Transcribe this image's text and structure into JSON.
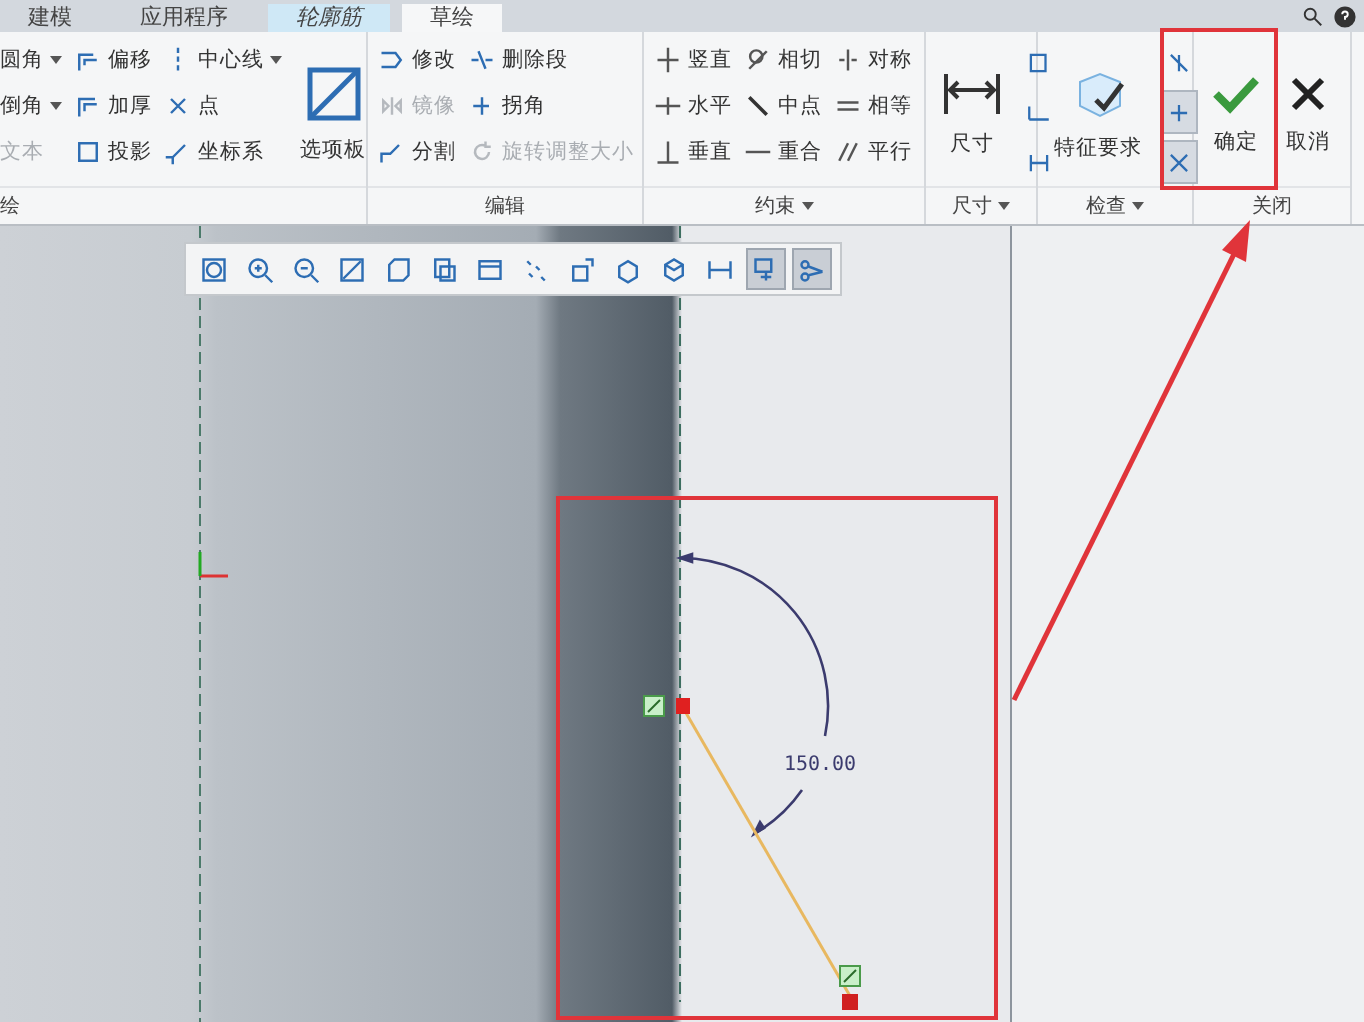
{
  "tabs": [
    {
      "label": "建模",
      "selected": false,
      "kind": "normal"
    },
    {
      "label": "应用程序",
      "selected": false,
      "kind": "normal"
    },
    {
      "label": "轮廓筋",
      "selected": false,
      "kind": "context"
    },
    {
      "label": "草绘",
      "selected": true,
      "kind": "normal"
    }
  ],
  "groups": [
    {
      "label": "绘",
      "has_menu": false,
      "blocks": [
        {
          "kind": "column",
          "items": [
            {
              "label": "圆角",
              "has_menu": true,
              "disabled": false
            },
            {
              "label": "倒角",
              "has_menu": true,
              "disabled": false
            },
            {
              "label": "文本",
              "has_menu": false,
              "disabled": true
            }
          ]
        },
        {
          "kind": "column",
          "items": [
            {
              "label": "偏移",
              "has_menu": false,
              "disabled": false
            },
            {
              "label": "加厚",
              "has_menu": false,
              "disabled": false
            },
            {
              "label": "投影",
              "has_menu": false,
              "disabled": false
            }
          ]
        },
        {
          "kind": "column",
          "items": [
            {
              "label": "中心线",
              "has_menu": true,
              "disabled": false
            },
            {
              "label": "点",
              "has_menu": false,
              "disabled": false
            },
            {
              "label": "坐标系",
              "has_menu": false,
              "disabled": false
            }
          ]
        },
        {
          "kind": "large",
          "label": "选项板"
        }
      ]
    },
    {
      "label": "编辑",
      "has_menu": false,
      "blocks": [
        {
          "kind": "column",
          "items": [
            {
              "label": "修改",
              "has_menu": false,
              "disabled": false
            },
            {
              "label": "镜像",
              "has_menu": false,
              "disabled": true
            },
            {
              "label": "分割",
              "has_menu": false,
              "disabled": false
            }
          ]
        },
        {
          "kind": "column",
          "items": [
            {
              "label": "删除段",
              "has_menu": false,
              "disabled": false
            },
            {
              "label": "拐角",
              "has_menu": false,
              "disabled": false
            },
            {
              "label": "旋转调整大小",
              "has_menu": false,
              "disabled": true
            }
          ]
        }
      ]
    },
    {
      "label": "约束",
      "has_menu": true,
      "blocks": [
        {
          "kind": "column",
          "items": [
            {
              "label": "竖直",
              "has_menu": false,
              "disabled": false
            },
            {
              "label": "水平",
              "has_menu": false,
              "disabled": false
            },
            {
              "label": "垂直",
              "has_menu": false,
              "disabled": false
            }
          ]
        },
        {
          "kind": "column",
          "items": [
            {
              "label": "相切",
              "has_menu": false,
              "disabled": false
            },
            {
              "label": "中点",
              "has_menu": false,
              "disabled": false
            },
            {
              "label": "重合",
              "has_menu": false,
              "disabled": false
            }
          ]
        },
        {
          "kind": "column",
          "items": [
            {
              "label": "对称",
              "has_menu": false,
              "disabled": false
            },
            {
              "label": "相等",
              "has_menu": false,
              "disabled": false
            },
            {
              "label": "平行",
              "has_menu": false,
              "disabled": false
            }
          ]
        }
      ]
    },
    {
      "label": "尺寸",
      "has_menu": true,
      "blocks": [
        {
          "kind": "large",
          "label": "尺寸"
        },
        {
          "kind": "icons",
          "items": [
            {
              "selected": false
            },
            {
              "selected": false
            },
            {
              "selected": false
            }
          ]
        }
      ]
    },
    {
      "label": "检查",
      "has_menu": true,
      "blocks": [
        {
          "kind": "large",
          "label": "特征要求"
        },
        {
          "kind": "icons",
          "items": [
            {
              "selected": false
            },
            {
              "selected": true
            },
            {
              "selected": true
            }
          ]
        }
      ]
    },
    {
      "label": "关闭",
      "has_menu": false,
      "blocks": [
        {
          "kind": "large",
          "label": "确定"
        },
        {
          "kind": "large",
          "label": "取消"
        }
      ]
    }
  ],
  "view_toolbar": [
    {
      "selected": false
    },
    {
      "selected": false
    },
    {
      "selected": false
    },
    {
      "selected": false
    },
    {
      "selected": false
    },
    {
      "selected": false
    },
    {
      "selected": false
    },
    {
      "selected": false
    },
    {
      "selected": false
    },
    {
      "selected": false
    },
    {
      "selected": false
    },
    {
      "selected": false
    },
    {
      "selected": true
    },
    {
      "selected": true
    }
  ],
  "sketch": {
    "dimension": "150.00"
  }
}
